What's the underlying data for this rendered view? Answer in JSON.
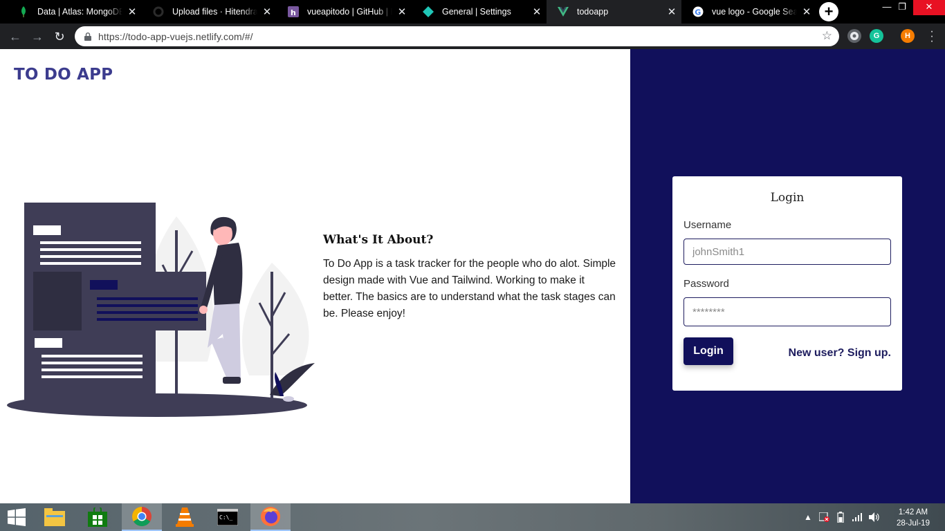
{
  "browser": {
    "tabs": [
      {
        "title": "Data | Atlas: MongoDB Atlas",
        "icon": "mongodb-leaf-icon",
        "active": false
      },
      {
        "title": "Upload files · HitendraSingh",
        "icon": "github-icon",
        "active": false
      },
      {
        "title": "vueapitodo | GitHub | Heroku",
        "icon": "heroku-icon",
        "active": false
      },
      {
        "title": "General | Settings",
        "icon": "netlify-icon",
        "active": false
      },
      {
        "title": "todoapp",
        "icon": "vue-icon",
        "active": true
      },
      {
        "title": "vue logo - Google Search",
        "icon": "google-icon",
        "active": false
      }
    ],
    "url": "https://todo-app-vuejs.netlify.com/#/",
    "profile_initial": "H",
    "ext_initial": "G"
  },
  "page": {
    "brand": "TO DO APP",
    "about": {
      "heading": "What's It About?",
      "body": "To Do App is a task tracker for the people who do alot. Simple design made with Vue and Tailwind. Working to make it better. The basics are to understand what the task stages can be. Please enjoy!"
    },
    "login": {
      "title": "Login",
      "username_label": "Username",
      "username_placeholder": "johnSmith1",
      "password_label": "Password",
      "password_placeholder": "********",
      "submit_label": "Login",
      "signup_link": "New user? Sign up."
    }
  },
  "taskbar": {
    "time": "1:42 AM",
    "date": "28-Jul-19"
  },
  "colors": {
    "panel": "#11105b",
    "brand": "#3c3c8e"
  }
}
